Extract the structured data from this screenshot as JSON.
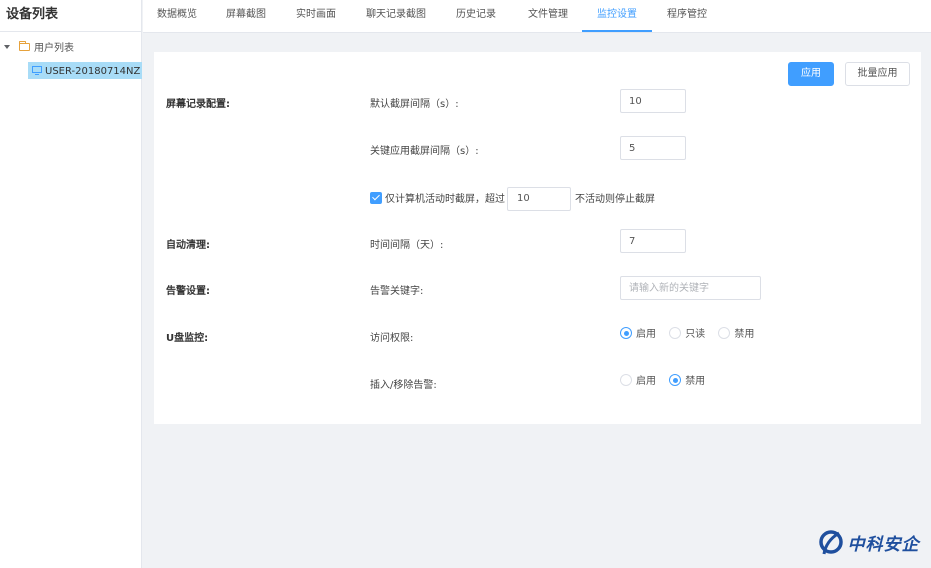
{
  "sidebar": {
    "title": "设备列表",
    "tree": {
      "root_label": "用户列表",
      "device_label": "USER-20180714NZ"
    }
  },
  "tabs": [
    {
      "label": "数据概览",
      "active": false
    },
    {
      "label": "屏幕截图",
      "active": false
    },
    {
      "label": "实时画面",
      "active": false
    },
    {
      "label": "聊天记录截图",
      "active": false
    },
    {
      "label": "历史记录",
      "active": false
    },
    {
      "label": "文件管理",
      "active": false
    },
    {
      "label": "监控设置",
      "active": true
    },
    {
      "label": "程序管控",
      "active": false
    }
  ],
  "toolbar": {
    "apply_label": "应用",
    "batch_apply_label": "批量应用"
  },
  "screen_record": {
    "section_label": "屏幕记录配置:",
    "default_interval_label": "默认截屏间隔（s）:",
    "default_interval_value": "10",
    "key_app_interval_label": "关键应用截屏间隔（s）:",
    "key_app_interval_value": "5",
    "active_only_checked": true,
    "active_only_prefix": "仅计算机活动时截屏，超过",
    "active_only_value": "10",
    "active_only_suffix": "不活动则停止截屏"
  },
  "auto_clean": {
    "section_label": "自动清理:",
    "interval_label": "时间间隔（天）:",
    "interval_value": "7"
  },
  "alert": {
    "section_label": "告警设置:",
    "keyword_label": "告警关键字:",
    "keyword_placeholder": "请输入新的关键字"
  },
  "usb": {
    "section_label": "U盘监控:",
    "access_label": "访问权限:",
    "access_options": [
      "启用",
      "只读",
      "禁用"
    ],
    "access_selected": "启用",
    "plug_alert_label": "插入/移除告警:",
    "plug_options": [
      "启用",
      "禁用"
    ],
    "plug_selected": "禁用"
  },
  "logo": {
    "text": "中科安企",
    "color": "#1f4f9e"
  },
  "colors": {
    "accent": "#409eff",
    "device_highlight": "#a8dcf7"
  }
}
